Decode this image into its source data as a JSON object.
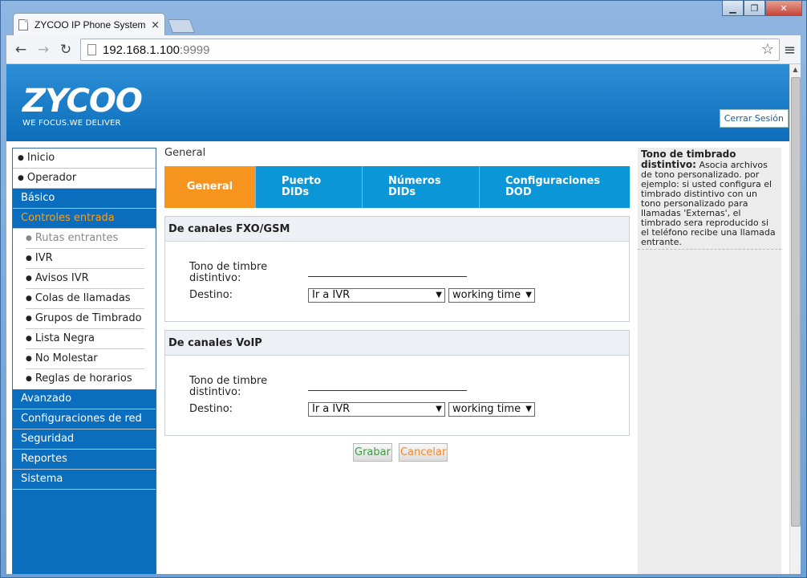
{
  "browser": {
    "tab_title": "ZYCOO IP Phone System (",
    "tab_close": "×",
    "url_host": "192.168.1.100",
    "url_port": ":9999",
    "back": "←",
    "forward": "→",
    "reload": "↻",
    "star": "☆",
    "menu": "≡",
    "minimize": "▁",
    "maximize": "❐",
    "close": "✕"
  },
  "header": {
    "logo_word": "ZYCOO",
    "logo_tagline": "WE FOCUS.WE DELIVER",
    "logout_label": "Cerrar Sesión"
  },
  "nav": {
    "items": [
      {
        "label": "Inicio"
      },
      {
        "label": "Operador"
      },
      {
        "label": "Básico"
      },
      {
        "label": "Controles entrada"
      },
      {
        "label": "Rutas entrantes"
      },
      {
        "label": "IVR"
      },
      {
        "label": "Avisos IVR"
      },
      {
        "label": "Colas de llamadas"
      },
      {
        "label": "Grupos de Timbrado"
      },
      {
        "label": "Lista Negra"
      },
      {
        "label": "No Molestar"
      },
      {
        "label": "Reglas de horarios"
      },
      {
        "label": "Avanzado"
      },
      {
        "label": "Configuraciones de red"
      },
      {
        "label": "Seguridad"
      },
      {
        "label": "Reportes"
      },
      {
        "label": "Sistema"
      }
    ]
  },
  "main": {
    "breadcrumb": "General",
    "tabs": [
      {
        "line1": "General",
        "line2": ""
      },
      {
        "line1": "Puerto",
        "line2": "DIDs"
      },
      {
        "line1": "Números",
        "line2": "DIDs"
      },
      {
        "line1": "Configuraciones",
        "line2": "DOD"
      }
    ],
    "fxo_panel": {
      "title": "De canales FXO/GSM",
      "ring_label_1": "Tono de timbre",
      "ring_label_2": "distintivo:",
      "ring_value": "",
      "dest_label": "Destino:",
      "dest_type": "Ir a IVR",
      "dest_value": "working time"
    },
    "voip_panel": {
      "title": "De canales VoIP",
      "ring_label_1": "Tono de timbre",
      "ring_label_2": "distintivo:",
      "ring_value": "",
      "dest_label": "Destino:",
      "dest_type": "Ir a IVR",
      "dest_value": "working time"
    },
    "save_label": "Grabar",
    "cancel_label": "Cancelar"
  },
  "help": {
    "title": "Tono de timbrado distintivo:",
    "text": " Asocia archivos de tono personalizado. por ejemplo: si usted configura el timbrado distintivo con un tono personalizado para llamadas 'Externas', el timbrado sera reproducido si el teléfono recibe una llamada entrante."
  },
  "colors": {
    "brand_blue": "#0b6dbd",
    "accent_orange": "#f7941e",
    "tab_blue": "#0b96d8"
  }
}
